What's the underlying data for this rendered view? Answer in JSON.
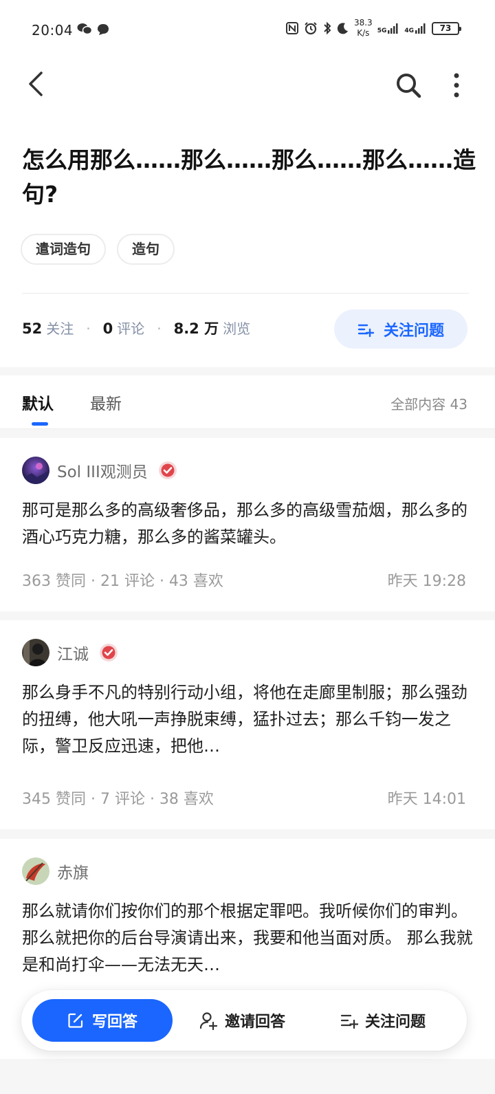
{
  "status_bar": {
    "time": "20:04",
    "net_speed_value": "38.3",
    "net_speed_unit": "K/s",
    "signal_1": "5G",
    "signal_2": "4G",
    "battery": "73",
    "icons": [
      "wechat-icon",
      "message-icon",
      "nfc-icon",
      "alarm-icon",
      "bluetooth-icon",
      "moon-icon"
    ]
  },
  "question": {
    "title": "怎么用那么……那么……那么……那么……造句?",
    "tags": [
      "遣词造句",
      "造句"
    ],
    "follow_count": "52",
    "follow_label": "关注",
    "comment_count": "0",
    "comment_label": "评论",
    "view_count": "8.2 万",
    "view_label": "浏览",
    "follow_button": "关注问题"
  },
  "tabs": {
    "default": "默认",
    "latest": "最新",
    "total": "全部内容 43"
  },
  "answers": [
    {
      "author": "Sol III观测员",
      "verified": true,
      "text": "那可是那么多的高级奢侈品，那么多的高级雪茄烟，那么多的酒心巧克力糖，那么多的酱菜罐头。",
      "meta": "363 赞同 · 21 评论 · 43 喜欢",
      "time": "昨天 19:28"
    },
    {
      "author": "江诚",
      "verified": true,
      "text": "那么身手不凡的特别行动小组，将他在走廊里制服；那么强劲的扭缚，他大吼一声挣脱束缚，猛扑过去；那么千钧一发之际，警卫反应迅速，把他…",
      "meta": "345 赞同 · 7 评论 · 38 喜欢",
      "time": "昨天 14:01"
    },
    {
      "author": "赤旗",
      "verified": false,
      "text": "那么就请你们按你们的那个根据定罪吧。我听候你们的审判。 那么就把你的后台导演请出来，我要和他当面对质。 那么我就是和尚打伞——无法无天…",
      "meta": "",
      "time": ""
    }
  ],
  "bottom_bar": {
    "write": "写回答",
    "invite": "邀请回答",
    "follow": "关注问题"
  },
  "colors": {
    "accent": "#1a66ff",
    "accent_light": "#ebf1fd",
    "badge": "#e0454b"
  }
}
